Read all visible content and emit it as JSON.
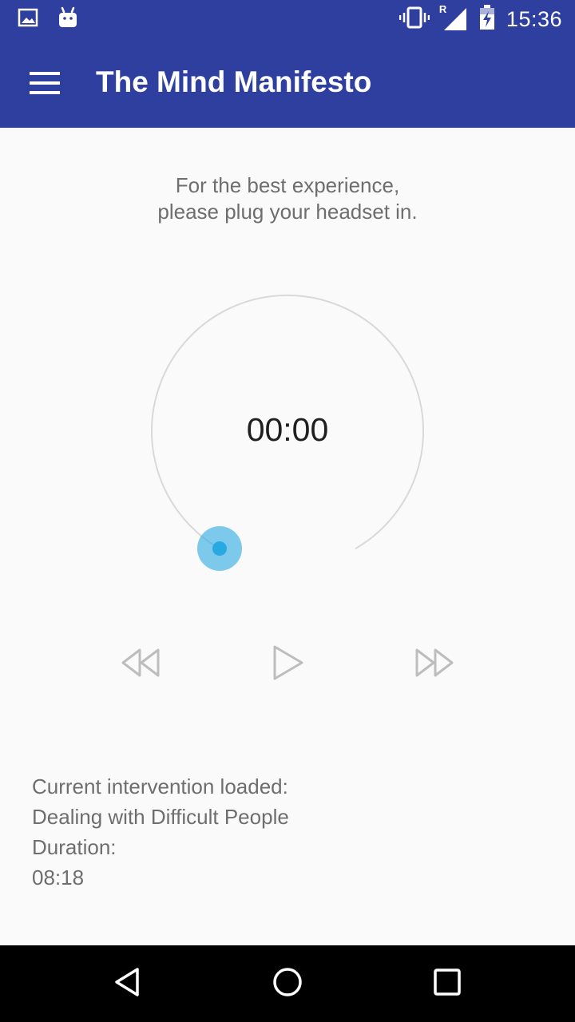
{
  "status_bar": {
    "time": "15:36",
    "left_icons": [
      "image-icon",
      "android-icon"
    ],
    "right_icons": [
      "vibrate-icon",
      "signal-icon",
      "battery-charging-icon"
    ],
    "roaming_label": "R"
  },
  "app_bar": {
    "title": "The Mind Manifesto",
    "menu_icon": "menu-icon",
    "background": "#2e3f9f"
  },
  "hint": {
    "line1": "For the best experience,",
    "line2": "please plug your headset in."
  },
  "player": {
    "time": "00:00",
    "progress": 0,
    "accent": "#29a9e1",
    "controls": [
      "rewind-icon",
      "play-icon",
      "fast-forward-icon"
    ]
  },
  "info": {
    "loaded_label": "Current intervention loaded:",
    "intervention_name": "Dealing with Difficult People",
    "duration_label": "Duration:",
    "duration_value": "08:18"
  },
  "nav_bar": {
    "icons": [
      "back-icon",
      "home-icon",
      "recents-icon"
    ]
  }
}
